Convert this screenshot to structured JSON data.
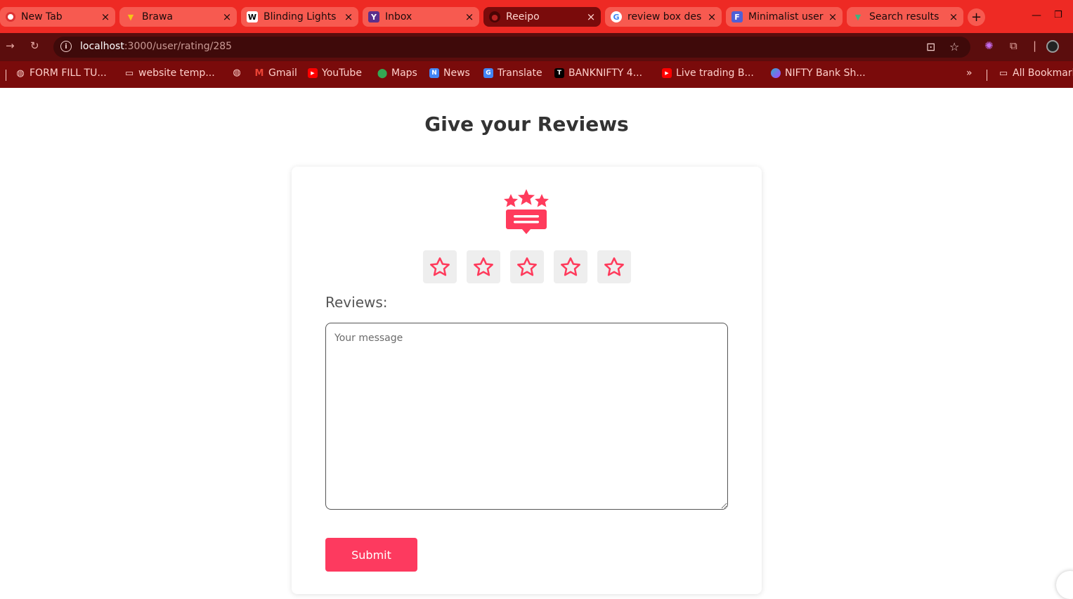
{
  "browser": {
    "tabs": [
      {
        "title": "New Tab",
        "icon": "chrome-icon",
        "active": false
      },
      {
        "title": "Brawa",
        "icon": "vite-icon",
        "active": false
      },
      {
        "title": "Blinding Lights",
        "icon": "wikipedia-icon",
        "active": false
      },
      {
        "title": "Inbox",
        "icon": "yahoo-icon",
        "active": false
      },
      {
        "title": "Reeipo",
        "icon": "site-icon",
        "active": true
      },
      {
        "title": "review box des",
        "icon": "google-icon",
        "active": false
      },
      {
        "title": "Minimalist user",
        "icon": "forms-icon",
        "active": false
      },
      {
        "title": "Search results",
        "icon": "vue-icon",
        "active": false
      }
    ],
    "url_host": "localhost",
    "url_path": ":3000/user/rating/285",
    "bookmarks": [
      {
        "label": "FORM FILL TU...",
        "icon": "globe-icon"
      },
      {
        "label": "website temp...",
        "icon": "folder-icon"
      },
      {
        "label": "",
        "icon": "globe-icon"
      },
      {
        "label": "Gmail",
        "icon": "gmail-icon"
      },
      {
        "label": "YouTube",
        "icon": "youtube-icon"
      },
      {
        "label": "Maps",
        "icon": "maps-icon"
      },
      {
        "label": "News",
        "icon": "news-icon"
      },
      {
        "label": "Translate",
        "icon": "translate-icon"
      },
      {
        "label": "BANKNIFTY 4...",
        "icon": "tradingview-icon"
      },
      {
        "label": "Live trading B...",
        "icon": "youtube-icon"
      },
      {
        "label": "NIFTY Bank Sh...",
        "icon": "site-icon"
      }
    ],
    "all_bookmarks": "All Bookmarks"
  },
  "page": {
    "title": "Give your Reviews",
    "rating": 0,
    "star_count": 5,
    "reviews_label": "Reviews:",
    "message_placeholder": "Your message",
    "message_value": "",
    "submit_label": "Submit"
  },
  "colors": {
    "accent": "#fd3a5f",
    "star": "#ff3b5c",
    "tabbar": "#ee2a24",
    "toolbar": "#5b0d0d",
    "bookmarkbar": "#7a0b0b"
  }
}
